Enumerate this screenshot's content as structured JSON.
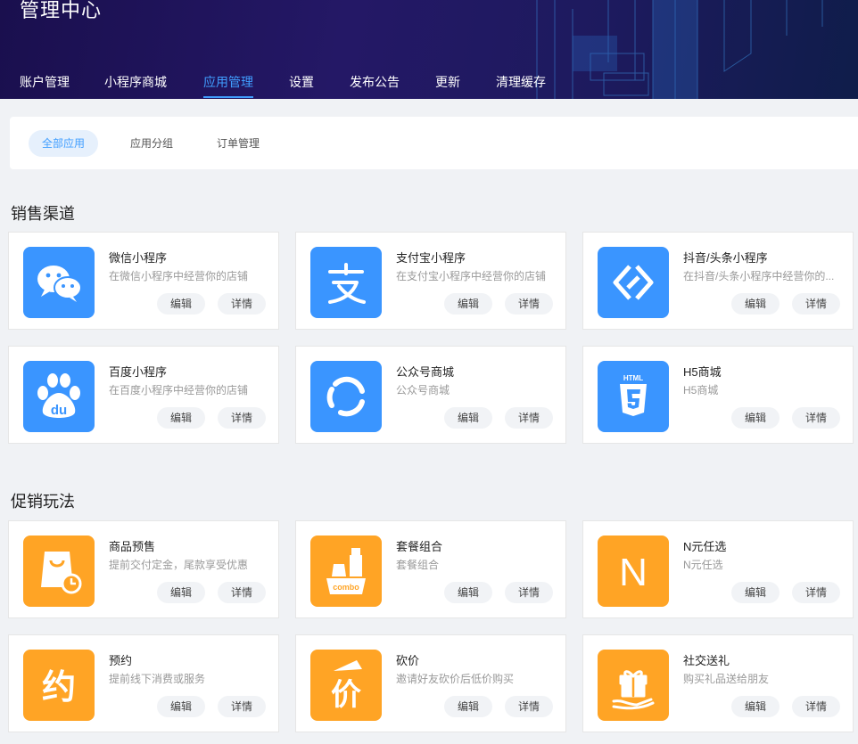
{
  "header": {
    "title": "管理中心",
    "nav": [
      {
        "label": "账户管理"
      },
      {
        "label": "小程序商城"
      },
      {
        "label": "应用管理"
      },
      {
        "label": "设置"
      },
      {
        "label": "发布公告"
      },
      {
        "label": "更新"
      },
      {
        "label": "清理缓存"
      }
    ],
    "active_nav": "应用管理"
  },
  "tabs": [
    {
      "label": "全部应用"
    },
    {
      "label": "应用分组"
    },
    {
      "label": "订单管理"
    }
  ],
  "active_tab": "全部应用",
  "colors": {
    "accent": "#409eff",
    "icon_blue": "#3a95ff",
    "icon_orange": "#ffa425"
  },
  "sections": [
    {
      "title": "销售渠道",
      "apps": [
        {
          "name": "微信小程序",
          "desc": "在微信小程序中经营你的店铺",
          "icon": "wechat-icon",
          "edit": "编辑",
          "detail": "详情"
        },
        {
          "name": "支付宝小程序",
          "desc": "在支付宝小程序中经营你的店铺",
          "icon": "alipay-icon",
          "edit": "编辑",
          "detail": "详情"
        },
        {
          "name": "抖音/头条小程序",
          "desc": "在抖音/头条小程序中经营你的...",
          "icon": "douyin-icon",
          "edit": "编辑",
          "detail": "详情"
        },
        {
          "name": "百度小程序",
          "desc": "在百度小程序中经营你的店铺",
          "icon": "baidu-icon",
          "edit": "编辑",
          "detail": "详情"
        },
        {
          "name": "公众号商城",
          "desc": "公众号商城",
          "icon": "official-account-icon",
          "edit": "编辑",
          "detail": "详情"
        },
        {
          "name": "H5商城",
          "desc": "H5商城",
          "icon": "html5-icon",
          "edit": "编辑",
          "detail": "详情"
        }
      ]
    },
    {
      "title": "促销玩法",
      "apps": [
        {
          "name": "商品预售",
          "desc": "提前交付定金，尾款享受优惠",
          "icon": "presale-icon",
          "edit": "编辑",
          "detail": "详情"
        },
        {
          "name": "套餐组合",
          "desc": "套餐组合",
          "icon": "combo-icon",
          "edit": "编辑",
          "detail": "详情"
        },
        {
          "name": "N元任选",
          "desc": "N元任选",
          "icon": "n-choice-icon",
          "icon_text": "N",
          "edit": "编辑",
          "detail": "详情"
        },
        {
          "name": "预约",
          "desc": "提前线下消费或服务",
          "icon": "reservation-icon",
          "icon_text": "约",
          "edit": "编辑",
          "detail": "详情"
        },
        {
          "name": "砍价",
          "desc": "邀请好友砍价后低价购买",
          "icon": "bargain-icon",
          "icon_text": "价",
          "edit": "编辑",
          "detail": "详情"
        },
        {
          "name": "社交送礼",
          "desc": "购买礼品送给朋友",
          "icon": "gift-icon",
          "edit": "编辑",
          "detail": "详情"
        }
      ]
    }
  ],
  "combo_icon_text": "combo",
  "html5_icon_text": "HTML"
}
